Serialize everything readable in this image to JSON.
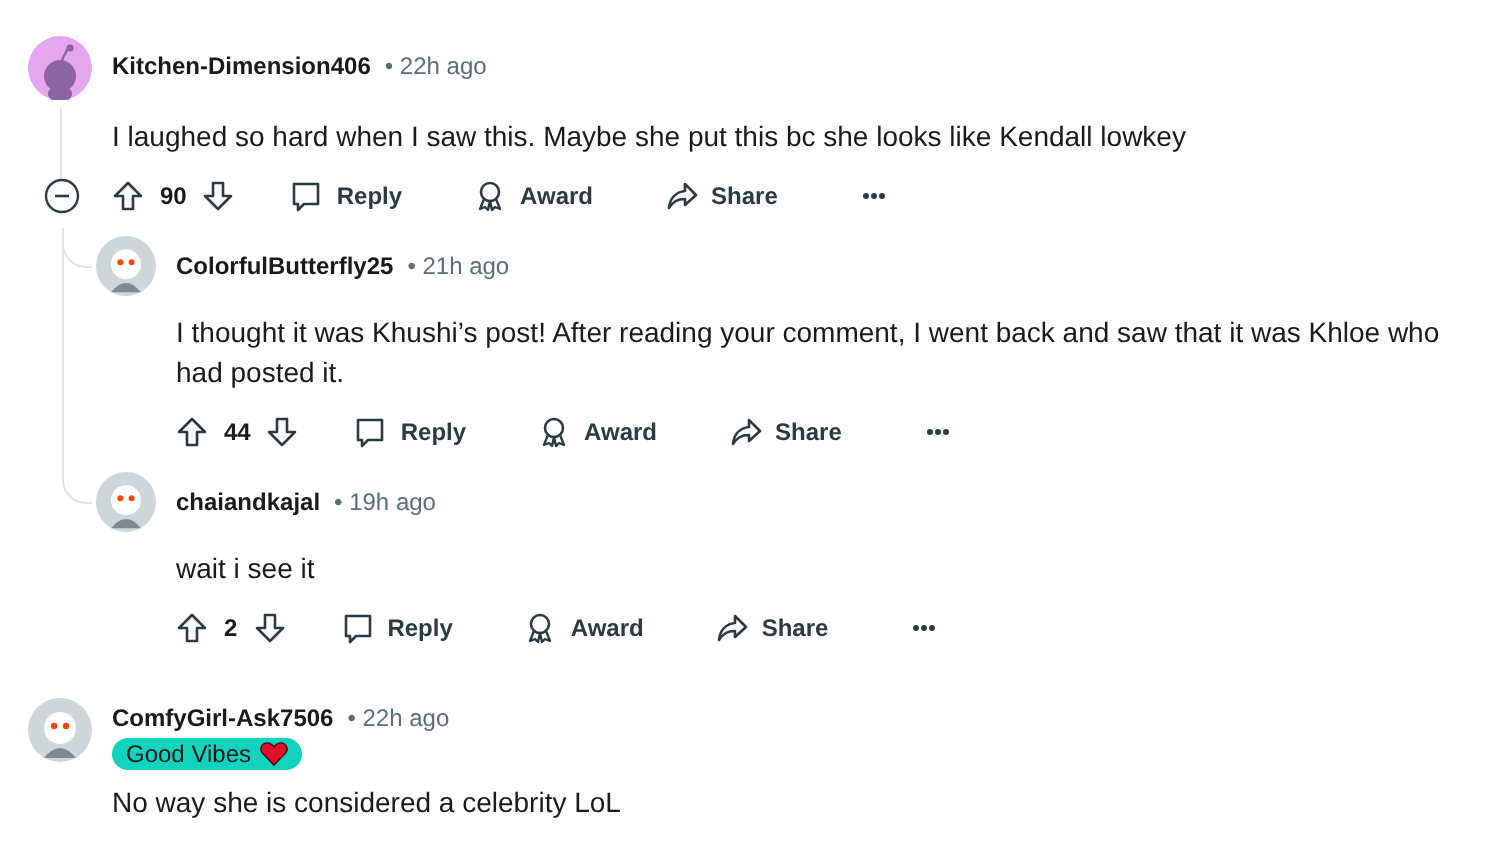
{
  "comments": [
    {
      "author": "Kitchen-Dimension406",
      "time": "• 22h ago",
      "avatar": {
        "kind": "default"
      },
      "body": "I laughed so hard when I saw this. Maybe she put this bc she looks like Kendall lowkey",
      "votes": "90",
      "expanded": true,
      "actions": [
        "Reply",
        "Award",
        "Share"
      ],
      "replies": [
        {
          "author": "ColorfulButterfly25",
          "time": "• 21h ago",
          "avatar": {
            "kind": "custom"
          },
          "body": "I thought it was Khushi’s post! After reading your comment, I went back and saw that it was Khloe who had posted it.",
          "votes": "44",
          "actions": [
            "Reply",
            "Award",
            "Share"
          ]
        },
        {
          "author": "chaiandkajal",
          "time": "• 19h ago",
          "avatar": {
            "kind": "custom"
          },
          "body": "wait i see it",
          "votes": "2",
          "actions": [
            "Reply",
            "Award",
            "Share"
          ]
        }
      ]
    },
    {
      "author": "ComfyGirl-Ask7506",
      "time": "• 22h ago",
      "avatar": {
        "kind": "custom"
      },
      "flair": "Good Vibes",
      "body": "No way she is considered a celebrity LoL"
    }
  ]
}
